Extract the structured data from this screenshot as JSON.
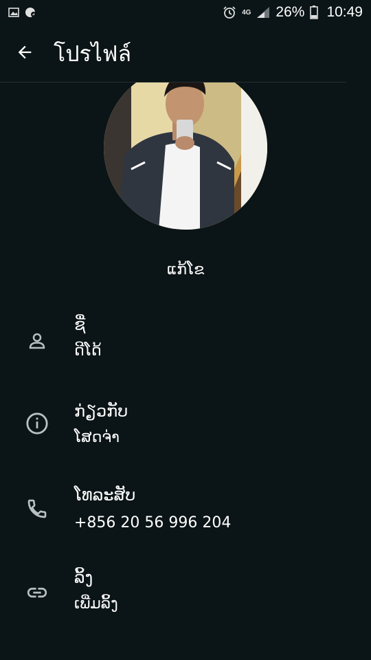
{
  "status_bar": {
    "network": "4G",
    "battery": "26%",
    "time": "10:49"
  },
  "app_bar": {
    "title": "โปรไฟล์"
  },
  "profile": {
    "name": "ແກ້ໂຂ"
  },
  "rows": [
    {
      "icon": "person-icon",
      "label": "ຊື່",
      "value": "ດີໂດ້"
    },
    {
      "icon": "info-icon",
      "label": "ກ່ຽວກັບ",
      "value": "ໂສດຈ່າ"
    },
    {
      "icon": "phone-icon",
      "label": "ໂທລະສັບ",
      "value": "+856 20 56 996 204"
    },
    {
      "icon": "link-icon",
      "label": "ລິ້ງ",
      "value": "ເພີ່ມລິ້ງ"
    }
  ],
  "colors": {
    "background": "#0b1416",
    "icon": "#b8c0c2",
    "text": "#ffffff"
  }
}
